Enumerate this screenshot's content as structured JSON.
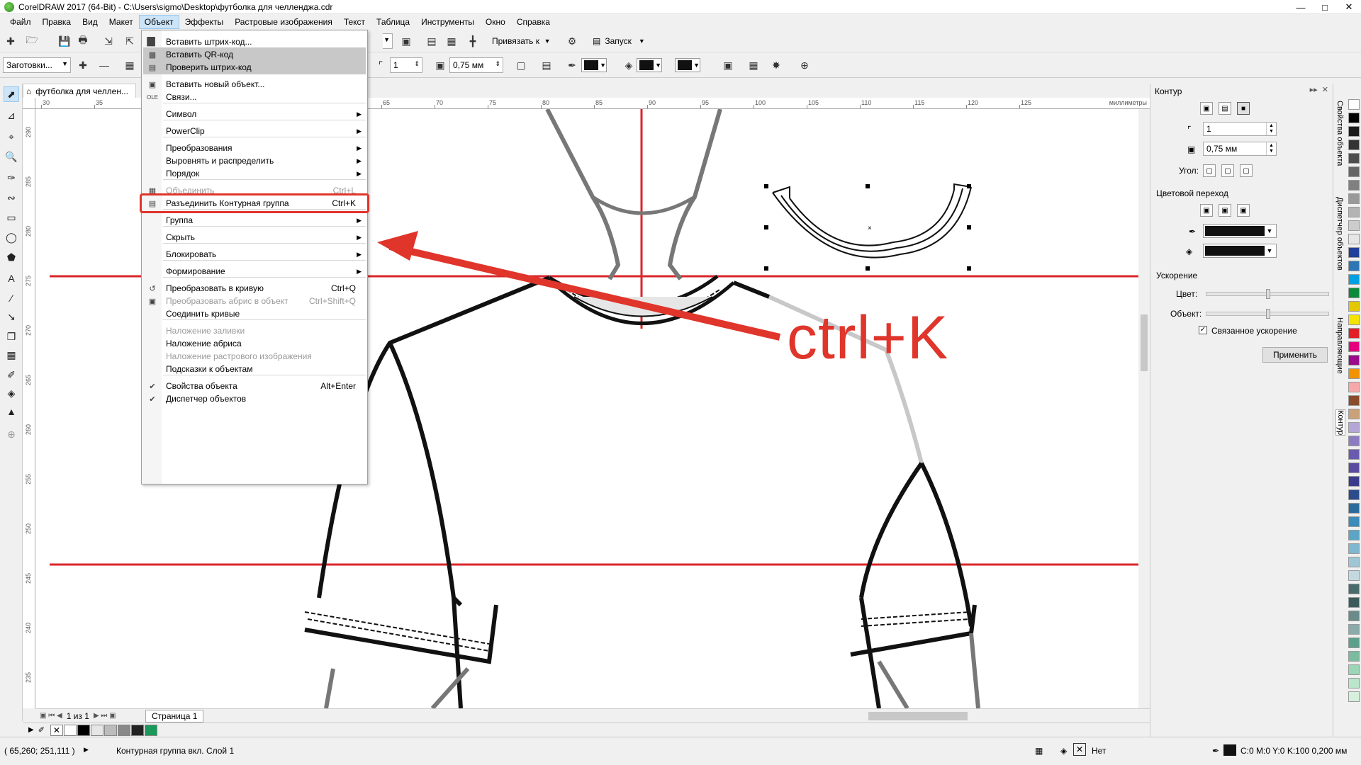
{
  "window": {
    "title": "CorelDRAW 2017 (64-Bit) - C:\\Users\\sigmo\\Desktop\\футболка для челленджа.cdr"
  },
  "menubar": [
    "Файл",
    "Правка",
    "Вид",
    "Макет",
    "Объект",
    "Эффекты",
    "Растровые изображения",
    "Текст",
    "Таблица",
    "Инструменты",
    "Окно",
    "Справка"
  ],
  "toolbar1": {
    "snap_label": "Привязать к",
    "launch_label": "Запуск"
  },
  "toolbar2": {
    "presets": "Заготовки...",
    "outline_width_1": "1",
    "outline_width_2": "0,75 мм"
  },
  "document": {
    "tab": "футболка для челлен...",
    "ruler_unit": "миллиметры",
    "ruler_h_ticks": [
      "30",
      "35",
      "65",
      "70",
      "75",
      "80",
      "85",
      "90",
      "95",
      "100",
      "105",
      "110",
      "115",
      "120",
      "125"
    ],
    "ruler_v_ticks": [
      "290",
      "285",
      "280",
      "275",
      "270",
      "265",
      "260",
      "255",
      "250",
      "245",
      "240",
      "235"
    ]
  },
  "menu": {
    "items": [
      {
        "icon": "barcode-icon",
        "label": "Вставить штрих-код...",
        "shortcut": "",
        "sub": false,
        "state": "normal"
      },
      {
        "icon": "qrcode-icon",
        "label": "Вставить QR-код",
        "shortcut": "",
        "sub": false,
        "state": "hover"
      },
      {
        "icon": "check-barcode-icon",
        "label": "Проверить штрих-код",
        "shortcut": "",
        "sub": false,
        "state": "hover"
      },
      {
        "icon": "new-object-icon",
        "label": "Вставить новый объект...",
        "shortcut": "",
        "sub": false,
        "state": "normal"
      },
      {
        "icon": "ole-icon",
        "label": "Связи...",
        "shortcut": "",
        "sub": false,
        "state": "normal"
      },
      {
        "icon": "",
        "label": "Символ",
        "shortcut": "",
        "sub": true,
        "state": "normal"
      },
      {
        "icon": "",
        "label": "PowerClip",
        "shortcut": "",
        "sub": true,
        "state": "normal"
      },
      {
        "icon": "",
        "label": "Преобразования",
        "shortcut": "",
        "sub": true,
        "state": "normal"
      },
      {
        "icon": "",
        "label": "Выровнять и распределить",
        "shortcut": "",
        "sub": true,
        "state": "normal"
      },
      {
        "icon": "",
        "label": "Порядок",
        "shortcut": "",
        "sub": true,
        "state": "normal"
      },
      {
        "icon": "combine-icon",
        "label": "Объединить",
        "shortcut": "Ctrl+L",
        "sub": false,
        "state": "disabled"
      },
      {
        "icon": "break-apart-icon",
        "label": "Разъединить Контурная группа",
        "shortcut": "Ctrl+K",
        "sub": false,
        "state": "highlighted"
      },
      {
        "icon": "",
        "label": "Группа",
        "shortcut": "",
        "sub": true,
        "state": "normal"
      },
      {
        "icon": "",
        "label": "Скрыть",
        "shortcut": "",
        "sub": true,
        "state": "normal"
      },
      {
        "icon": "",
        "label": "Блокировать",
        "shortcut": "",
        "sub": true,
        "state": "normal"
      },
      {
        "icon": "",
        "label": "Формирование",
        "shortcut": "",
        "sub": true,
        "state": "normal"
      },
      {
        "icon": "convert-curve-icon",
        "label": "Преобразовать в кривую",
        "shortcut": "Ctrl+Q",
        "sub": false,
        "state": "normal"
      },
      {
        "icon": "convert-outline-icon",
        "label": "Преобразовать абрис в объект",
        "shortcut": "Ctrl+Shift+Q",
        "sub": false,
        "state": "disabled"
      },
      {
        "icon": "",
        "label": "Соединить кривые",
        "shortcut": "",
        "sub": false,
        "state": "normal"
      },
      {
        "icon": "",
        "label": "Наложение заливки",
        "shortcut": "",
        "sub": false,
        "state": "disabled"
      },
      {
        "icon": "",
        "label": "Наложение абриса",
        "shortcut": "",
        "sub": false,
        "state": "normal"
      },
      {
        "icon": "",
        "label": "Наложение растрового изображения",
        "shortcut": "",
        "sub": false,
        "state": "disabled"
      },
      {
        "icon": "",
        "label": "Подсказки к объектам",
        "shortcut": "",
        "sub": false,
        "state": "normal"
      },
      {
        "icon": "checkmark-icon",
        "label": "Свойства объекта",
        "shortcut": "Alt+Enter",
        "sub": false,
        "state": "normal"
      },
      {
        "icon": "checkmark-icon",
        "label": "Диспетчер объектов",
        "shortcut": "",
        "sub": false,
        "state": "normal"
      }
    ]
  },
  "annotation": {
    "text": "ctrl+K",
    "color": "#e0352b"
  },
  "pagenav": {
    "counter": "1 из 1",
    "page_tab": "Страница 1"
  },
  "statusbar": {
    "coords": "( 65,260; 251,111 )",
    "selection": "Контурная группа вкл. Слой 1",
    "fill": "Нет",
    "outline": "C:0 M:0 Y:0 K:100  0,200 мм"
  },
  "right_panel": {
    "title": "Контур",
    "width_value": "1",
    "mm_value": "0,75 мм",
    "angle_label": "Угол:",
    "color_blend_label": "Цветовой переход",
    "acceleration_label": "Ускорение",
    "color_label": "Цвет:",
    "object_label": "Объект:",
    "linked_label": "Связанное ускорение",
    "apply_label": "Применить"
  },
  "docker_tabs": [
    "Свойства объекта",
    "Диспетчер объектов",
    "Направляющие",
    "Контур"
  ],
  "colors": {
    "accent_red": "#e0352b",
    "guide_red": "#d9262b",
    "menu_highlight": "#c8c8c8"
  }
}
